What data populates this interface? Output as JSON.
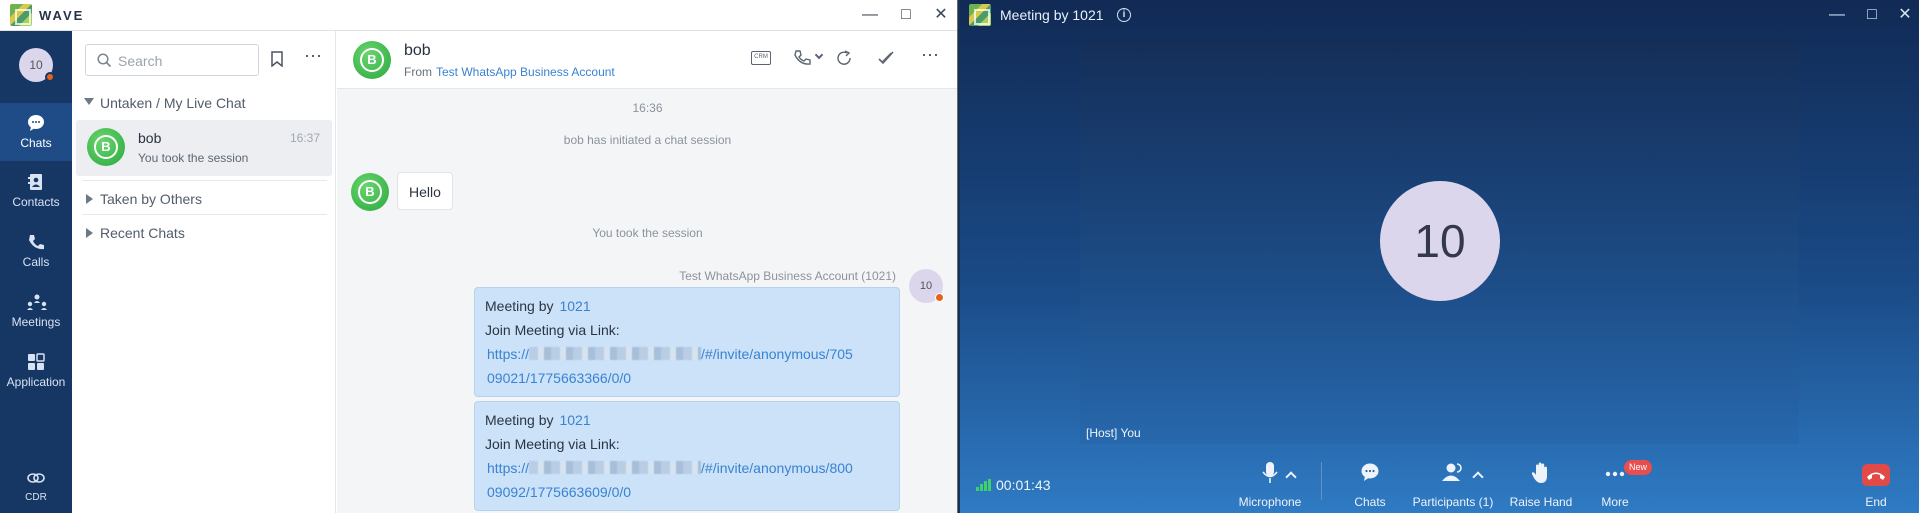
{
  "wave": {
    "title": "WAVE",
    "nav": {
      "avatar": "10",
      "items": [
        {
          "label": "Chats",
          "icon": "chat-bubble-icon"
        },
        {
          "label": "Contacts",
          "icon": "contact-book-icon"
        },
        {
          "label": "Calls",
          "icon": "phone-icon"
        },
        {
          "label": "Meetings",
          "icon": "meetings-icon"
        },
        {
          "label": "Application",
          "icon": "grid-icon"
        },
        {
          "label": "CDR",
          "icon": "cdr-icon"
        }
      ]
    },
    "list": {
      "search_placeholder": "Search",
      "sections": {
        "untaken": "Untaken / My Live Chat",
        "taken": "Taken by Others",
        "recent": "Recent Chats"
      },
      "conversation": {
        "avatar": "B",
        "name": "bob",
        "time": "16:37",
        "preview": "You took the session"
      }
    },
    "chat": {
      "name": "bob",
      "from_label": "From",
      "account": "Test WhatsApp Business Account",
      "crm_label": "CRM",
      "time_divider": "16:36",
      "initiated": "bob has initiated a chat session",
      "hello": "Hello",
      "took": "You took the session",
      "sender": "Test WhatsApp Business Account (1021)",
      "me_avatar": "10",
      "messages": [
        {
          "meeting_by": "Meeting by",
          "meeting_num": "1021",
          "join": "Join Meeting via Link:",
          "link_prefix": "https://",
          "link_path": "/#/invite/anonymous/705",
          "link_rest": "09021/1775663366/0/0"
        },
        {
          "meeting_by": "Meeting by",
          "meeting_num": "1021",
          "join": "Join Meeting via Link:",
          "link_prefix": "https://",
          "link_path": "/#/invite/anonymous/800",
          "link_rest": "09092/1775663609/0/0"
        }
      ]
    }
  },
  "meeting": {
    "title": "Meeting by 1021",
    "avatar": "10",
    "host_label": "[Host] You",
    "timer": "00:01:43",
    "controls": {
      "microphone": "Microphone",
      "chats": "Chats",
      "participants": "Participants (1)",
      "raise_hand": "Raise Hand",
      "more": "More",
      "new_badge": "New",
      "end": "End"
    }
  }
}
